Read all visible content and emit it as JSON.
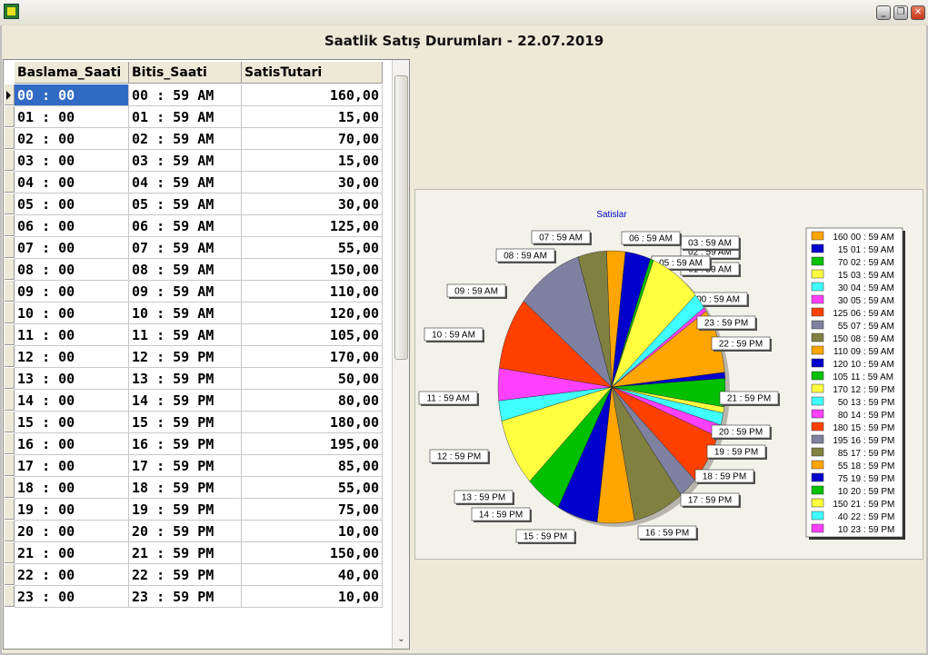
{
  "window": {
    "title": "Saatlik Satış Durumları - 22.07.2019"
  },
  "grid": {
    "columns": [
      "Baslama_Saati",
      "Bitis_Saati",
      "SatisTutari"
    ],
    "rows": [
      [
        "00 : 00",
        "00 : 59 AM",
        "160,00"
      ],
      [
        "01 : 00",
        "01 : 59 AM",
        "15,00"
      ],
      [
        "02 : 00",
        "02 : 59 AM",
        "70,00"
      ],
      [
        "03 : 00",
        "03 : 59 AM",
        "15,00"
      ],
      [
        "04 : 00",
        "04 : 59 AM",
        "30,00"
      ],
      [
        "05 : 00",
        "05 : 59 AM",
        "30,00"
      ],
      [
        "06 : 00",
        "06 : 59 AM",
        "125,00"
      ],
      [
        "07 : 00",
        "07 : 59 AM",
        "55,00"
      ],
      [
        "08 : 00",
        "08 : 59 AM",
        "150,00"
      ],
      [
        "09 : 00",
        "09 : 59 AM",
        "110,00"
      ],
      [
        "10 : 00",
        "10 : 59 AM",
        "120,00"
      ],
      [
        "11 : 00",
        "11 : 59 AM",
        "105,00"
      ],
      [
        "12 : 00",
        "12 : 59 PM",
        "170,00"
      ],
      [
        "13 : 00",
        "13 : 59 PM",
        "50,00"
      ],
      [
        "14 : 00",
        "14 : 59 PM",
        "80,00"
      ],
      [
        "15 : 00",
        "15 : 59 PM",
        "180,00"
      ],
      [
        "16 : 00",
        "16 : 59 PM",
        "195,00"
      ],
      [
        "17 : 00",
        "17 : 59 PM",
        "85,00"
      ],
      [
        "18 : 00",
        "18 : 59 PM",
        "55,00"
      ],
      [
        "19 : 00",
        "19 : 59 PM",
        "75,00"
      ],
      [
        "20 : 00",
        "20 : 59 PM",
        "10,00"
      ],
      [
        "21 : 00",
        "21 : 59 PM",
        "150,00"
      ],
      [
        "22 : 00",
        "22 : 59 PM",
        "40,00"
      ],
      [
        "23 : 00",
        "23 : 59 PM",
        "10,00"
      ]
    ],
    "selected_row": 0
  },
  "chart_data": {
    "type": "pie",
    "title": "Satislar",
    "categories": [
      "00 : 59 AM",
      "01 : 59 AM",
      "02 : 59 AM",
      "03 : 59 AM",
      "04 : 59 AM",
      "05 : 59 AM",
      "06 : 59 AM",
      "07 : 59 AM",
      "08 : 59 AM",
      "09 : 59 AM",
      "10 : 59 AM",
      "11 : 59 AM",
      "12 : 59 PM",
      "13 : 59 PM",
      "14 : 59 PM",
      "15 : 59 PM",
      "16 : 59 PM",
      "17 : 59 PM",
      "18 : 59 PM",
      "19 : 59 PM",
      "20 : 59 PM",
      "21 : 59 PM",
      "22 : 59 PM",
      "23 : 59 PM"
    ],
    "values": [
      160,
      15,
      70,
      15,
      30,
      30,
      125,
      55,
      150,
      110,
      120,
      105,
      170,
      50,
      80,
      180,
      195,
      85,
      55,
      75,
      10,
      150,
      40,
      10
    ],
    "legend_position": "right",
    "colors": [
      "#ffa500",
      "#0000cc",
      "#00c000",
      "#ffff40",
      "#40ffff",
      "#ff40ff",
      "#ff4000",
      "#8080a0",
      "#808040",
      "#ffa500",
      "#0000cc",
      "#00c000",
      "#ffff40",
      "#40ffff",
      "#ff40ff",
      "#ff4000",
      "#8080a0",
      "#808040",
      "#ffa500",
      "#0000cc",
      "#00c000",
      "#ffff40",
      "#40ffff",
      "#ff40ff"
    ]
  }
}
